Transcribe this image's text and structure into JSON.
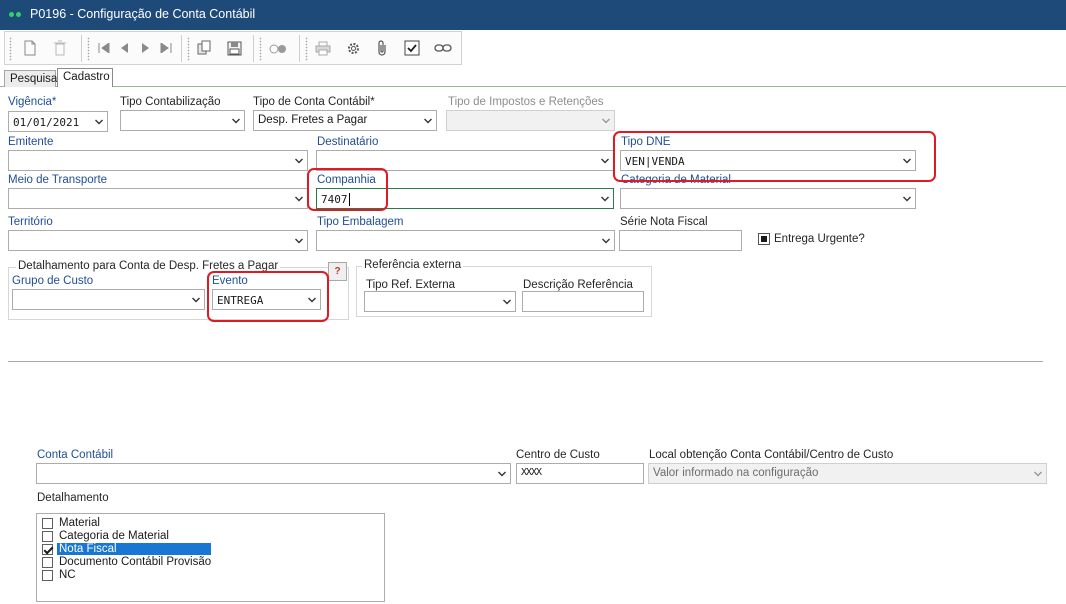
{
  "window": {
    "title": "P0196 - Configuração de Conta Contábil"
  },
  "toolbar": {
    "buttons": [
      {
        "icon": "new-document-icon"
      },
      {
        "icon": "delete-icon"
      },
      {
        "icon": "first-record-icon"
      },
      {
        "icon": "previous-record-icon"
      },
      {
        "icon": "next-record-icon"
      },
      {
        "icon": "last-record-icon"
      },
      {
        "icon": "copy-icon"
      },
      {
        "icon": "save-icon"
      },
      {
        "icon": "binoculars-icon"
      },
      {
        "icon": "print-icon"
      },
      {
        "icon": "gear-icon"
      },
      {
        "icon": "attachment-icon"
      },
      {
        "icon": "check-icon"
      },
      {
        "icon": "link-icon"
      }
    ]
  },
  "tabs": [
    {
      "label": "Pesquisa"
    },
    {
      "label": "Cadastro"
    }
  ],
  "form": {
    "vigencia": {
      "label": "Vigência*",
      "value": "01/01/2021"
    },
    "tipo_contabilizacao": {
      "label": "Tipo Contabilização",
      "value": ""
    },
    "tipo_conta_contabil": {
      "label": "Tipo de Conta Contábil*",
      "value": "Desp. Fretes a Pagar"
    },
    "tipo_impostos": {
      "label": "Tipo de Impostos e Retenções",
      "value": ""
    },
    "emitente": {
      "label": "Emitente",
      "value": ""
    },
    "destinatario": {
      "label": "Destinatário",
      "value": ""
    },
    "tipo_dne": {
      "label": "Tipo DNE",
      "value": "VEN|VENDA"
    },
    "meio_transporte": {
      "label": "Meio de Transporte",
      "value": ""
    },
    "companhia": {
      "label": "Companhia",
      "value": "7407"
    },
    "categoria_material": {
      "label": "Categoria de Material",
      "value": ""
    },
    "territorio": {
      "label": "Território",
      "value": ""
    },
    "tipo_embalagem": {
      "label": "Tipo Embalagem",
      "value": ""
    },
    "serie_nota_fiscal": {
      "label": "Série Nota Fiscal",
      "value": ""
    },
    "entrega_urgente": {
      "label": "Entrega Urgente?"
    },
    "detalhamento_group": {
      "title": "Detalhamento para Conta de Desp. Fretes a Pagar",
      "help_label": "?",
      "grupo_custo": {
        "label": "Grupo de Custo",
        "value": ""
      },
      "evento": {
        "label": "Evento",
        "value": "ENTREGA"
      }
    },
    "referencia_externa": {
      "title": "Referência externa",
      "tipo_ref": {
        "label": "Tipo Ref. Externa",
        "value": ""
      },
      "descricao_ref": {
        "label": "Descrição Referência",
        "value": ""
      }
    },
    "conta_contabil": {
      "label": "Conta Contábil",
      "value": ""
    },
    "centro_custo": {
      "label": "Centro de Custo",
      "value": "XXXX"
    },
    "local_obtencao": {
      "label": "Local obtenção Conta Contábil/Centro de Custo",
      "value": "Valor informado na configuração"
    },
    "detalhamento": {
      "label": "Detalhamento",
      "items": [
        {
          "label": "Material",
          "checked": false
        },
        {
          "label": "Categoria de Material",
          "checked": false
        },
        {
          "label": "Nota Fiscal",
          "checked": true
        },
        {
          "label": "Documento Contábil Provisão",
          "checked": false
        },
        {
          "label": "NC",
          "checked": false
        }
      ]
    }
  },
  "colors": {
    "titlebar": "#1e4a7a",
    "label_blue": "#1f4d96",
    "highlight": "#e01a24",
    "selection": "#1976d2"
  }
}
